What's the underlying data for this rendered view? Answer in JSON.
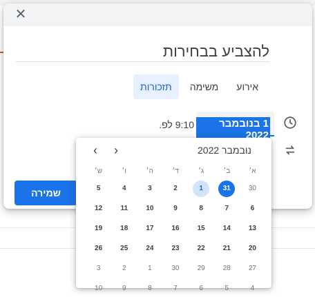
{
  "dialog": {
    "title": "להצביע בבחירות",
    "tabs": [
      {
        "label": "אירוע",
        "active": false
      },
      {
        "label": "משימה",
        "active": false
      },
      {
        "label": "תזכורות",
        "active": true
      }
    ],
    "date_value": "1 בנובמבר 2022",
    "time_value": "9:10 לפ.",
    "save_label": "שמירה",
    "accent_color": "#1a73e8"
  },
  "calendar": {
    "month_label": "נובמבר 2022",
    "weekdays": [
      "א׳",
      "ב׳",
      "ג׳",
      "ד׳",
      "ה׳",
      "ו׳",
      "ש׳"
    ],
    "weeks": [
      [
        {
          "d": "30",
          "other": true
        },
        {
          "d": "31",
          "selected": true
        },
        {
          "d": "1",
          "today": true
        },
        {
          "d": "2"
        },
        {
          "d": "3"
        },
        {
          "d": "4"
        },
        {
          "d": "5"
        }
      ],
      [
        {
          "d": "6"
        },
        {
          "d": "7"
        },
        {
          "d": "8"
        },
        {
          "d": "9"
        },
        {
          "d": "10"
        },
        {
          "d": "11"
        },
        {
          "d": "12"
        }
      ],
      [
        {
          "d": "13"
        },
        {
          "d": "14"
        },
        {
          "d": "15"
        },
        {
          "d": "16"
        },
        {
          "d": "17"
        },
        {
          "d": "18"
        },
        {
          "d": "19"
        }
      ],
      [
        {
          "d": "20"
        },
        {
          "d": "21"
        },
        {
          "d": "22"
        },
        {
          "d": "23"
        },
        {
          "d": "24"
        },
        {
          "d": "25"
        },
        {
          "d": "26"
        }
      ],
      [
        {
          "d": "27",
          "other": true
        },
        {
          "d": "28",
          "other": true
        },
        {
          "d": "29",
          "other": true
        },
        {
          "d": "30",
          "other": true
        },
        {
          "d": "1",
          "other": true
        },
        {
          "d": "2",
          "other": true
        },
        {
          "d": "3",
          "other": true
        }
      ],
      [
        {
          "d": "4",
          "other": true
        },
        {
          "d": "5",
          "other": true
        },
        {
          "d": "6",
          "other": true
        },
        {
          "d": "7",
          "other": true
        },
        {
          "d": "8",
          "other": true
        },
        {
          "d": "9",
          "other": true
        },
        {
          "d": "10",
          "other": true
        }
      ]
    ]
  }
}
